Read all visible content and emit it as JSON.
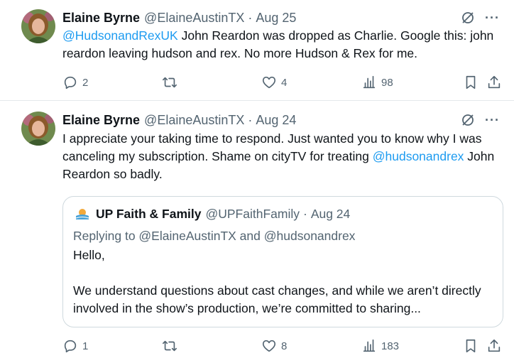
{
  "tweets": [
    {
      "author": {
        "name": "Elaine Byrne",
        "handle": "@ElaineAustinTX"
      },
      "separator": "·",
      "time": "Aug 25",
      "text": {
        "mention": "@HudsonandRexUK",
        "rest": " John Reardon was dropped as Charlie.  Google this: john reardon leaving hudson and rex.  No more Hudson & Rex for me."
      },
      "stats": {
        "replies": "2",
        "reposts": "",
        "likes": "4",
        "views": "98"
      }
    },
    {
      "author": {
        "name": "Elaine Byrne",
        "handle": "@ElaineAustinTX"
      },
      "separator": "·",
      "time": "Aug 24",
      "text": {
        "part1": "I appreciate your taking time to respond. Just wanted you to know why I was canceling my subscription. Shame on cityTV for treating ",
        "mention": "@hudsonandrex",
        "part2": " John Reardon so badly."
      },
      "quote": {
        "author": {
          "name": "UP Faith & Family",
          "handle": "@UPFaithFamily"
        },
        "separator": "·",
        "time": "Aug 24",
        "replying": "Replying to @ElaineAustinTX and @hudsonandrex",
        "paragraphs": [
          "Hello,",
          "We understand questions about cast changes, and while we aren’t directly involved in the show’s production, we’re committed to sharing..."
        ]
      },
      "stats": {
        "replies": "1",
        "reposts": "",
        "likes": "8",
        "views": "183"
      }
    }
  ],
  "icons": {
    "reply": "reply-icon",
    "repost": "repost-icon",
    "like": "heart-icon",
    "views": "views-chart-icon",
    "bookmark": "bookmark-icon",
    "share": "share-icon",
    "grok": "grok-icon",
    "more": "more-icon"
  },
  "more_glyph": "···",
  "colors": {
    "link": "#1d9bf0",
    "secondary": "#536471",
    "text": "#0f1419",
    "border": "#cfd9de"
  }
}
